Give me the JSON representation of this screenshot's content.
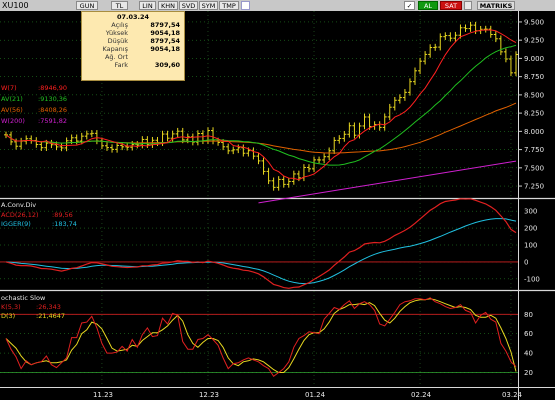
{
  "toolbar": {
    "title": "XU100",
    "buttons": [
      "GUN",
      "TL",
      "LIN",
      "KHN",
      "SVD",
      "SYM",
      "TMP"
    ],
    "check": "✓",
    "al": "AL",
    "sat": "SAT",
    "matriks": "MATRIKS"
  },
  "info_box": {
    "date": "07.03.24",
    "rows": [
      {
        "label": "Açılış",
        "value": "8797,54"
      },
      {
        "label": "Yüksek",
        "value": "9054,18"
      },
      {
        "label": "Düşük",
        "value": "8797,54"
      },
      {
        "label": "Kapanış",
        "value": "9054,18"
      },
      {
        "label": "Ağ. Ort",
        "value": ""
      },
      {
        "label": "Fark",
        "value": "309,60"
      }
    ]
  },
  "colors": {
    "background": "#000000",
    "price_bar": "#e8d820",
    "ma7": "#ff2020",
    "ma21": "#20c020",
    "ma56": "#e06000",
    "ma200": "#d020d0",
    "macd": "#e02020",
    "trigger": "#20c0e0",
    "stoch_k": "#e02020",
    "stoch_d": "#e8d820",
    "grid": "#2a9a2a",
    "ref_line": "#d02020"
  },
  "chart_data": [
    {
      "type": "line",
      "panel": "price",
      "x_labels": [
        "11.23",
        "12.23",
        "01.24",
        "02.24",
        "03.24"
      ],
      "legend": [
        {
          "label": "W(7)",
          "value": ":8946,90"
        },
        {
          "label": "AV(21)",
          "value": ":9130,36"
        },
        {
          "label": "AV(56)",
          "value": ":8408,26"
        },
        {
          "label": "W(200)",
          "value": ":7591,82"
        }
      ],
      "y_ticks": [
        "9.500",
        "9.250",
        "9.000",
        "8.750",
        "8.500",
        "8.250",
        "8.000",
        "7.750",
        "7.500",
        "7.250"
      ],
      "ylim": [
        7100,
        9650
      ],
      "closes": [
        7952,
        7856,
        7796,
        7866,
        7899,
        7875,
        7820,
        7776,
        7838,
        7816,
        7787,
        7773,
        7871,
        7912,
        7867,
        7934,
        7965,
        7973,
        7869,
        7802,
        7777,
        7753,
        7807,
        7788,
        7782,
        7822,
        7812,
        7889,
        7817,
        7878,
        7844,
        7963,
        7906,
        7965,
        8002,
        7883,
        7925,
        7853,
        7970,
        7871,
        8011,
        7868,
        7848,
        7788,
        7733,
        7747,
        7775,
        7700,
        7735,
        7660,
        7595,
        7451,
        7322,
        7232,
        7341,
        7273,
        7313,
        7416,
        7363,
        7505,
        7486,
        7609,
        7608,
        7652,
        7734,
        7876,
        7903,
        7960,
        8077,
        7947,
        8074,
        8197,
        8066,
        8093,
        8054,
        8198,
        8331,
        8426,
        8463,
        8535,
        8681,
        8830,
        8962,
        9055,
        9149,
        9155,
        9298,
        9313,
        9277,
        9318,
        9420,
        9409,
        9456,
        9379,
        9400,
        9402,
        9328,
        9269,
        9090,
        8992,
        8802,
        9054
      ],
      "ma7": [
        7952,
        7904,
        7868,
        7868,
        7874,
        7874,
        7866,
        7855,
        7869,
        7836,
        7822,
        7804,
        7806,
        7810,
        7812,
        7831,
        7865,
        7899,
        7914,
        7904,
        7883,
        7863,
        7843,
        7826,
        7797,
        7802,
        7792,
        7808,
        7799,
        7817,
        7824,
        7834,
        7845,
        7895,
        7916,
        7925,
        7912,
        7919,
        7924,
        7925,
        7940,
        7926,
        7897,
        7865,
        7866,
        7806,
        7793,
        7782,
        7762,
        7723,
        7707,
        7653,
        7577,
        7479,
        7447,
        7388,
        7359,
        7355,
        7337,
        7374,
        7390,
        7415,
        7467,
        7522,
        7589,
        7651,
        7695,
        7789,
        7861,
        7886,
        7952,
        8004,
        8046,
        8076,
        8101,
        8090,
        8130,
        8196,
        8227,
        8270,
        8332,
        8415,
        8514,
        8592,
        8701,
        8804,
        8932,
        9049,
        9148,
        9226,
        9296,
        9322,
        9351,
        9371,
        9387,
        9390,
        9391,
        9377,
        9340,
        9301,
        9253,
        9217
      ],
      "ma21": [
        7952,
        7904,
        7868,
        7868,
        7874,
        7874,
        7866,
        7855,
        7856,
        7852,
        7845,
        7839,
        7842,
        7847,
        7848,
        7854,
        7860,
        7866,
        7866,
        7863,
        7858,
        7850,
        7849,
        7846,
        7840,
        7836,
        7827,
        7833,
        7830,
        7828,
        7834,
        7843,
        7845,
        7850,
        7863,
        7863,
        7864,
        7860,
        7865,
        7869,
        7881,
        7885,
        7885,
        7880,
        7873,
        7871,
        7869,
        7860,
        7857,
        7846,
        7836,
        7812,
        7781,
        7754,
        7732,
        7703,
        7675,
        7655,
        7627,
        7607,
        7585,
        7568,
        7556,
        7547,
        7537,
        7538,
        7539,
        7549,
        7568,
        7582,
        7608,
        7650,
        7687,
        7726,
        7760,
        7804,
        7854,
        7903,
        7956,
        8011,
        8067,
        8127,
        8183,
        8238,
        8296,
        8361,
        8420,
        8492,
        8558,
        8633,
        8693,
        8762,
        8832,
        8893,
        8947,
        9007,
        9054,
        9092,
        9121,
        9147,
        9161,
        9180
      ],
      "ma56": [
        7952,
        7904,
        7868,
        7868,
        7874,
        7874,
        7866,
        7855,
        7856,
        7852,
        7845,
        7839,
        7842,
        7847,
        7848,
        7854,
        7860,
        7866,
        7866,
        7863,
        7858,
        7850,
        7849,
        7846,
        7843,
        7842,
        7841,
        7843,
        7842,
        7843,
        7843,
        7847,
        7849,
        7852,
        7857,
        7858,
        7860,
        7860,
        7863,
        7863,
        7867,
        7867,
        7867,
        7865,
        7861,
        7858,
        7856,
        7852,
        7849,
        7844,
        7838,
        7828,
        7815,
        7801,
        7790,
        7777,
        7765,
        7753,
        7744,
        7735,
        7723,
        7714,
        7710,
        7704,
        7703,
        7702,
        7704,
        7708,
        7712,
        7716,
        7718,
        7724,
        7727,
        7731,
        7732,
        7740,
        7750,
        7762,
        7775,
        7791,
        7810,
        7830,
        7850,
        7874,
        7899,
        7928,
        7956,
        7989,
        8016,
        8044,
        8073,
        8103,
        8132,
        8162,
        8191,
        8221,
        8249,
        8280,
        8305,
        8329,
        8357,
        8387
      ],
      "ma200_start": 7020,
      "ma200_end": 7592
    },
    {
      "type": "line",
      "panel": "macd",
      "title": "A.Conv.Div",
      "legend": [
        {
          "label": "ACD(26,12)",
          "value": ":89,56"
        },
        {
          "label": "IGGER(9)",
          "value": ":183,74"
        }
      ],
      "y_ticks": [
        "300",
        "200",
        "100",
        "0",
        "-100"
      ],
      "ylim": [
        -160,
        360
      ],
      "macd": [
        0,
        -8,
        -19,
        -22,
        -22,
        -24,
        -31,
        -39,
        -40,
        -43,
        -49,
        -54,
        -47,
        -38,
        -34,
        -24,
        -13,
        -4,
        -5,
        -11,
        -18,
        -26,
        -28,
        -31,
        -33,
        -31,
        -30,
        -23,
        -23,
        -18,
        -16,
        -7,
        -5,
        0,
        7,
        3,
        3,
        -3,
        1,
        -4,
        5,
        -1,
        -8,
        -18,
        -30,
        -37,
        -41,
        -49,
        -52,
        -60,
        -70,
        -88,
        -111,
        -133,
        -141,
        -152,
        -156,
        -150,
        -148,
        -135,
        -123,
        -103,
        -86,
        -68,
        -48,
        -20,
        4,
        29,
        58,
        67,
        84,
        106,
        111,
        115,
        113,
        122,
        138,
        157,
        171,
        186,
        205,
        228,
        254,
        279,
        305,
        323,
        344,
        357,
        362,
        366,
        373,
        372,
        373,
        364,
        353,
        343,
        326,
        305,
        272,
        238,
        192,
        173
      ],
      "signal": [
        0,
        -2,
        -5,
        -9,
        -11,
        -14,
        -17,
        -21,
        -25,
        -29,
        -33,
        -37,
        -39,
        -39,
        -38,
        -35,
        -31,
        -26,
        -22,
        -20,
        -20,
        -21,
        -22,
        -24,
        -26,
        -27,
        -28,
        -27,
        -26,
        -25,
        -23,
        -20,
        -17,
        -14,
        -9,
        -7,
        -5,
        -4,
        -3,
        -3,
        -2,
        -2,
        -3,
        -6,
        -11,
        -16,
        -21,
        -27,
        -32,
        -38,
        -44,
        -53,
        -64,
        -78,
        -90,
        -103,
        -114,
        -121,
        -126,
        -128,
        -127,
        -122,
        -115,
        -106,
        -95,
        -80,
        -64,
        -47,
        -28,
        -12,
        4,
        19,
        33,
        45,
        55,
        63,
        69,
        75,
        82,
        88,
        93,
        100,
        108,
        117,
        127,
        139,
        151,
        163,
        176,
        188,
        200,
        212,
        223,
        233,
        241,
        248,
        253,
        256,
        256,
        254,
        247,
        241
      ]
    },
    {
      "type": "line",
      "panel": "stochastic",
      "title": "ochastic Slow",
      "legend": [
        {
          "label": "K(5,3)",
          "value": ":26,343"
        },
        {
          "label": "D(3)",
          "value": ":21,4647"
        }
      ],
      "y_ticks": [
        "80",
        "60",
        "40",
        "20"
      ],
      "ylim": [
        5,
        102
      ],
      "levels": [
        80,
        20
      ],
      "k": [
        55,
        44,
        36,
        24,
        32,
        28,
        30,
        31,
        37,
        28,
        25,
        30,
        35,
        56,
        56,
        71,
        72,
        78,
        66,
        50,
        40,
        40,
        41,
        47,
        42,
        54,
        46,
        59,
        66,
        57,
        58,
        76,
        70,
        81,
        79,
        52,
        44,
        44,
        54,
        55,
        59,
        54,
        48,
        35,
        24,
        29,
        30,
        33,
        35,
        33,
        31,
        27,
        24,
        16,
        20,
        24,
        31,
        46,
        55,
        58,
        62,
        61,
        60,
        75,
        81,
        87,
        85,
        90,
        94,
        86,
        91,
        93,
        90,
        84,
        70,
        68,
        75,
        82,
        90,
        93,
        94,
        96,
        96,
        95,
        97,
        93,
        91,
        88,
        86,
        87,
        90,
        84,
        82,
        71,
        79,
        82,
        75,
        72,
        50,
        42,
        31,
        26
      ],
      "d": [
        55,
        50,
        45,
        37,
        31,
        28,
        30,
        31,
        32,
        30,
        30,
        31,
        33,
        43,
        49,
        60,
        64,
        72,
        70,
        65,
        55,
        45,
        42,
        43,
        44,
        48,
        47,
        53,
        57,
        61,
        61,
        64,
        68,
        74,
        79,
        73,
        59,
        50,
        46,
        51,
        55,
        55,
        53,
        46,
        35,
        29,
        27,
        31,
        32,
        34,
        33,
        31,
        27,
        23,
        20,
        20,
        25,
        34,
        44,
        53,
        59,
        61,
        61,
        65,
        72,
        81,
        85,
        87,
        90,
        90,
        91,
        90,
        92,
        89,
        81,
        74,
        71,
        76,
        83,
        88,
        92,
        94,
        95,
        95,
        96,
        95,
        93,
        91,
        89,
        87,
        88,
        87,
        85,
        79,
        77,
        77,
        79,
        76,
        66,
        55,
        41,
        21
      ]
    }
  ]
}
